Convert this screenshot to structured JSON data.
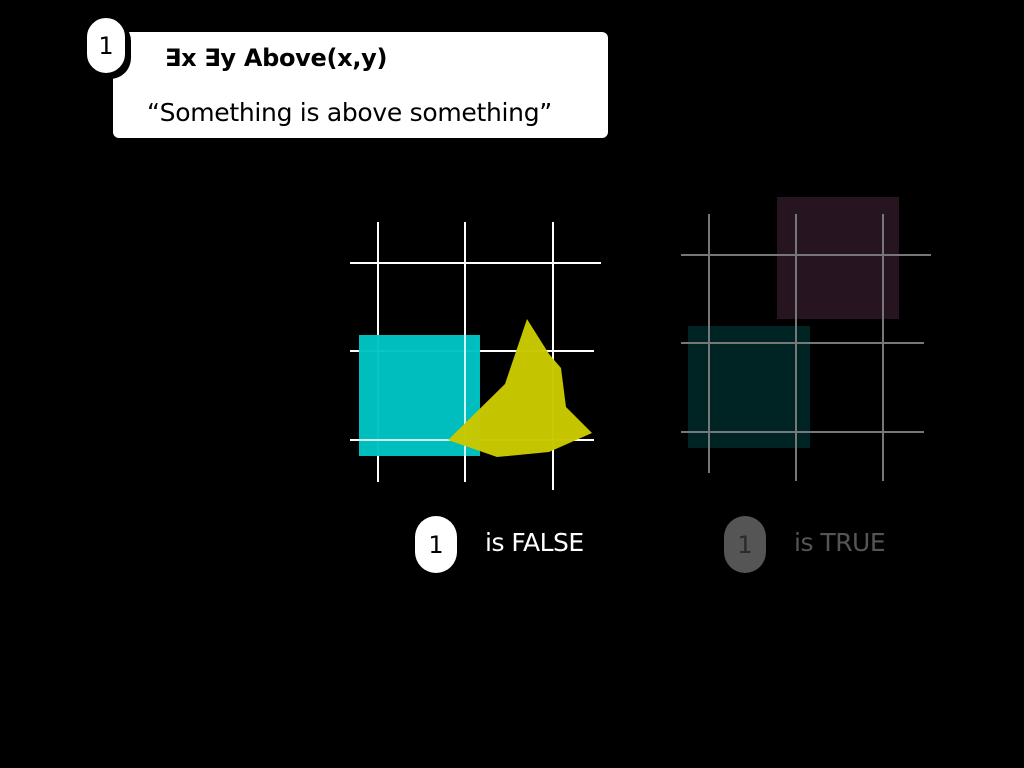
{
  "formula": {
    "badge": "1",
    "text": "∃x ∃y Above(x,y)",
    "gloss": "“Something is above something”"
  },
  "worlds": [
    {
      "badge": "1",
      "verdict": "is FALSE",
      "grid_color": "#ffffff",
      "objects": [
        {
          "shape": "square",
          "color": "#00c4c4"
        },
        {
          "shape": "blob",
          "color": "#c8c800"
        }
      ]
    },
    {
      "badge": "1",
      "verdict": "is TRUE",
      "grid_color": "#777777",
      "objects": [
        {
          "shape": "square",
          "color": "#002424"
        },
        {
          "shape": "square",
          "color": "#261521"
        }
      ]
    }
  ]
}
